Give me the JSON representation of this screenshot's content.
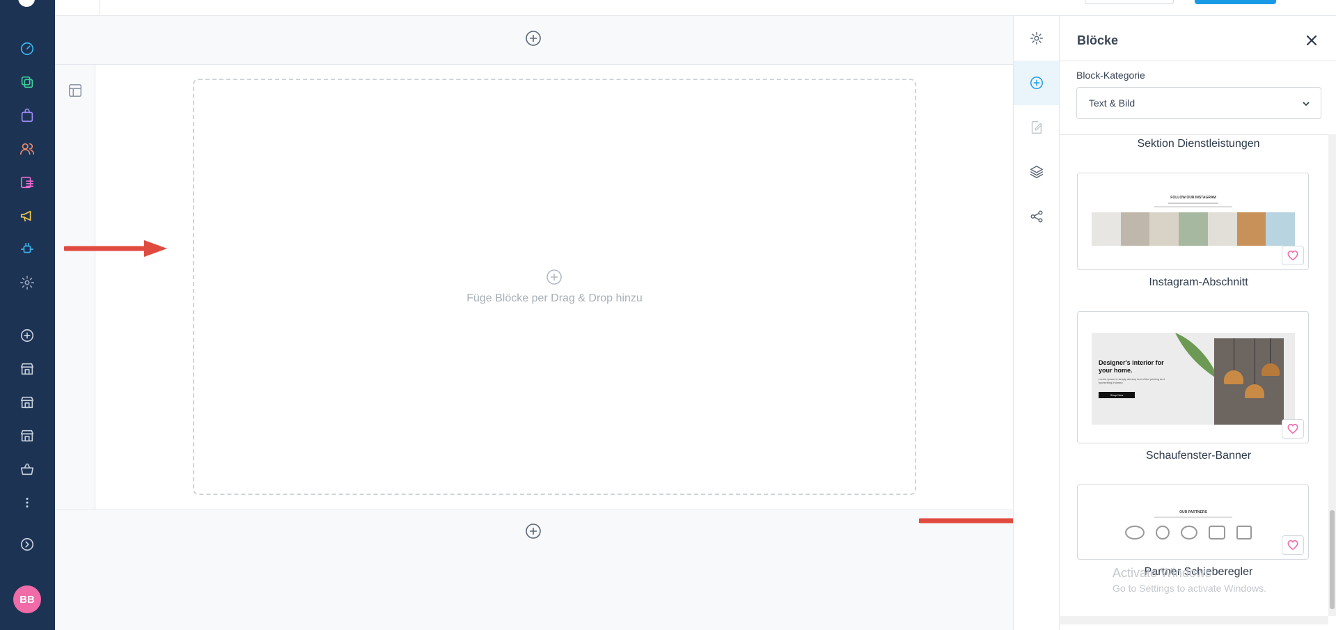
{
  "app": {
    "avatar_initials": "BB"
  },
  "sidebar": {
    "items": [
      {
        "icon": "dashboard-gauge-icon",
        "color": "#3fb6f0"
      },
      {
        "icon": "copy-pages-icon",
        "color": "#3fd09a"
      },
      {
        "icon": "shopping-bag-icon",
        "color": "#9b8cf5"
      },
      {
        "icon": "users-icon",
        "color": "#f08a6a"
      },
      {
        "icon": "content-list-icon",
        "color": "#f06bd0"
      },
      {
        "icon": "megaphone-icon",
        "color": "#f2c94c"
      },
      {
        "icon": "plug-connector-icon",
        "color": "#3fb6f0"
      },
      {
        "icon": "settings-gear-icon",
        "color": "#9aa5b5"
      },
      {
        "icon": "add-circle-icon",
        "color": "#c7cfda"
      },
      {
        "icon": "store-icon",
        "color": "#c7cfda"
      },
      {
        "icon": "store-icon",
        "color": "#c7cfda"
      },
      {
        "icon": "store-icon",
        "color": "#c7cfda"
      },
      {
        "icon": "basket-icon",
        "color": "#c7cfda"
      },
      {
        "icon": "more-vertical-icon",
        "color": "#c7cfda"
      },
      {
        "icon": "expand-circle-icon",
        "color": "#c7cfda"
      }
    ]
  },
  "canvas": {
    "dropzone_text": "Füge Blöcke per Drag & Drop hinzu"
  },
  "rail": {
    "items": [
      {
        "icon": "gear-icon"
      },
      {
        "icon": "add-block-icon",
        "active": true
      },
      {
        "icon": "edit-page-icon"
      },
      {
        "icon": "layers-icon"
      },
      {
        "icon": "share-nodes-icon"
      }
    ]
  },
  "panel": {
    "title": "Blöcke",
    "category_label": "Block-Kategorie",
    "category_value": "Text & Bild",
    "blocks": [
      {
        "name": "Sektion Dienstleistungen"
      },
      {
        "name": "Instagram-Abschnitt",
        "thumb_heading": "FOLLOW OUR INSTAGRAM"
      },
      {
        "name": "Schaufenster-Banner",
        "thumb_heading": "Designer's interior for your home.",
        "thumb_body": "Lorem Ipsum is simply dummy text of the printing and typesetting industry.",
        "thumb_button": "Shop Now"
      },
      {
        "name": "Partner Schieberegler",
        "thumb_heading": "OUR PARTNERS"
      }
    ]
  },
  "watermark": {
    "line1": "Activate Windows",
    "line2": "Go to Settings to activate Windows."
  },
  "colors": {
    "sidebar_bg": "#1c3354",
    "accent": "#1a9ae6",
    "arrow": "#e04a3f",
    "heart": "#f06ba8"
  }
}
